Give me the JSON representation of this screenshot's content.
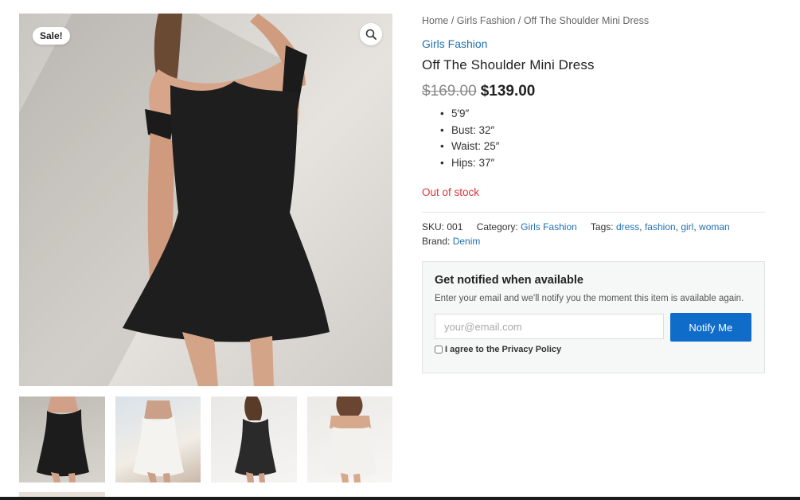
{
  "gallery": {
    "sale_badge": "Sale!",
    "zoom_icon": "search-icon",
    "thumbnails": [
      "black-dress-front",
      "white-dress-front",
      "black-dress-side",
      "white-dress-back"
    ]
  },
  "breadcrumb": {
    "home": "Home",
    "sep": " / ",
    "category": "Girls Fashion",
    "current": "Off The Shoulder Mini Dress"
  },
  "product": {
    "category_link": "Girls Fashion",
    "title": "Off The Shoulder Mini Dress",
    "old_price": "$169.00",
    "new_price": "$139.00",
    "specs": [
      "5′9″",
      "Bust: 32″",
      "Waist: 25″",
      "Hips: 37″"
    ],
    "stock": "Out of stock"
  },
  "meta": {
    "sku_label": "SKU:",
    "sku": "001",
    "category_label": "Category:",
    "category": "Girls Fashion",
    "tags_label": "Tags:",
    "tags": [
      "dress",
      "fashion",
      "girl",
      "woman"
    ],
    "brand_label": "Brand:",
    "brand": "Denim"
  },
  "notify": {
    "heading": "Get notified when available",
    "description": "Enter your email and we'll notify you the moment this item is available again.",
    "email_placeholder": "your@email.com",
    "button_label": "Notify Me",
    "agree_label": "I agree to the Privacy Policy"
  },
  "colors": {
    "link": "#2271b1",
    "out_of_stock": "#d63638",
    "button": "#0f6cc9"
  }
}
